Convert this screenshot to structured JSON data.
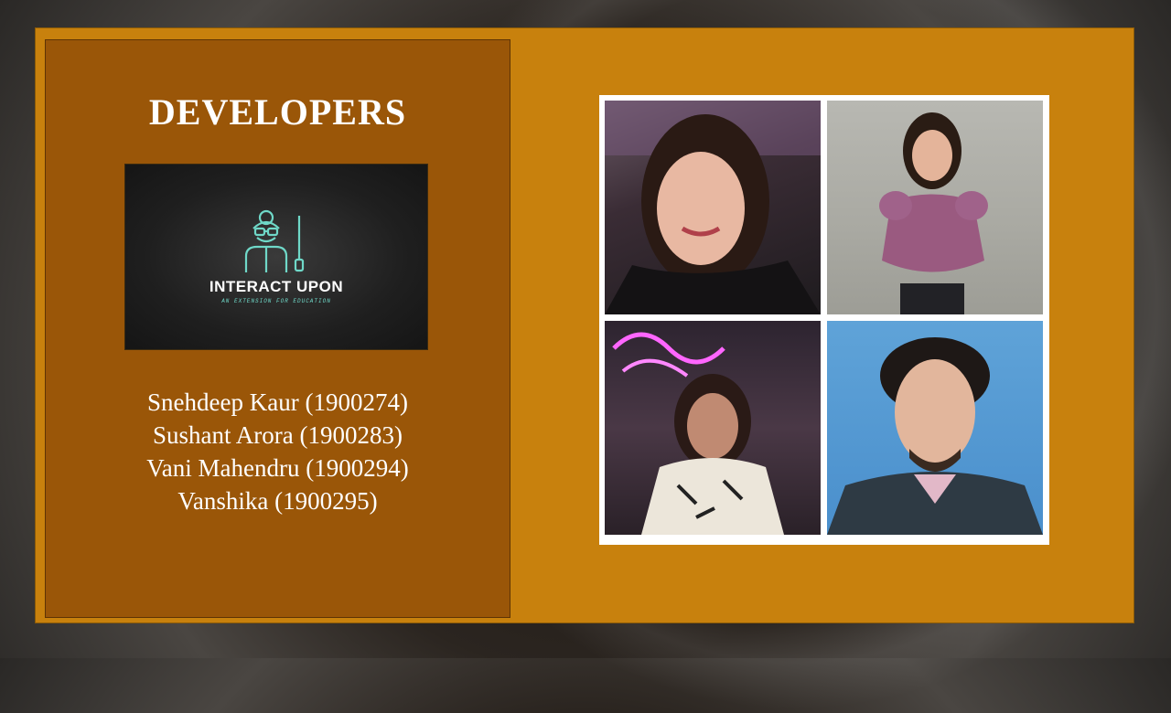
{
  "slide": {
    "title": "DEVELOPERS",
    "logo": {
      "name": "INTERACT UPON",
      "tagline": "AN EXTENSION FOR EDUCATION"
    },
    "developers": [
      "Snehdeep Kaur (1900274)",
      "Sushant Arora (1900283)",
      "Vani Mahendru (1900294)",
      "Vanshika (1900295)"
    ],
    "colors": {
      "frame": "#c8810d",
      "left_panel": "#9a5608",
      "logo_accent": "#6fd8c8",
      "text": "#ffffff"
    },
    "photos": [
      "developer-photo-1",
      "developer-photo-2",
      "developer-photo-3",
      "developer-photo-4"
    ]
  }
}
